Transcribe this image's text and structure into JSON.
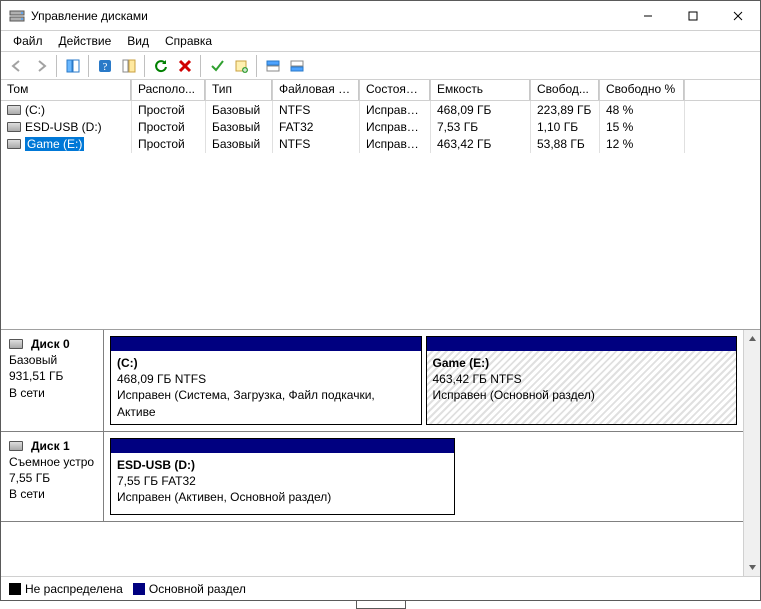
{
  "title": "Управление дисками",
  "menu": {
    "file": "Файл",
    "action": "Действие",
    "view": "Вид",
    "help": "Справка"
  },
  "columns": {
    "volume": "Том",
    "layout": "Располо...",
    "type": "Тип",
    "fs": "Файловая с...",
    "status": "Состояние",
    "capacity": "Емкость",
    "free": "Свобод...",
    "freepct": "Свободно %"
  },
  "volumes": [
    {
      "name": "(C:)",
      "layout": "Простой",
      "type": "Базовый",
      "fs": "NTFS",
      "status": "Исправен...",
      "capacity": "468,09 ГБ",
      "free": "223,89 ГБ",
      "freepct": "48 %",
      "selected": false
    },
    {
      "name": "ESD-USB (D:)",
      "layout": "Простой",
      "type": "Базовый",
      "fs": "FAT32",
      "status": "Исправен...",
      "capacity": "7,53 ГБ",
      "free": "1,10 ГБ",
      "freepct": "15 %",
      "selected": false
    },
    {
      "name": "Game (E:)",
      "layout": "Простой",
      "type": "Базовый",
      "fs": "NTFS",
      "status": "Исправен...",
      "capacity": "463,42 ГБ",
      "free": "53,88 ГБ",
      "freepct": "12 %",
      "selected": true
    }
  ],
  "disks": [
    {
      "label": "Диск 0",
      "type": "Базовый",
      "size": "931,51 ГБ",
      "state": "В сети",
      "partitions": [
        {
          "name": "(C:)",
          "line2": "468,09 ГБ NTFS",
          "line3": "Исправен (Система, Загрузка, Файл подкачки, Активе",
          "hatch": false
        },
        {
          "name": "Game  (E:)",
          "line2": "463,42 ГБ NTFS",
          "line3": "Исправен (Основной раздел)",
          "hatch": true
        }
      ]
    },
    {
      "label": "Диск 1",
      "type": "Съемное устро",
      "size": "7,55 ГБ",
      "state": "В сети",
      "partitions": [
        {
          "name": "ESD-USB  (D:)",
          "line2": "7,55 ГБ FAT32",
          "line3": "Исправен (Активен, Основной раздел)",
          "hatch": false,
          "flex": "0 0 55%"
        }
      ]
    }
  ],
  "legend": {
    "unallocated": "Не распределена",
    "primary": "Основной раздел"
  }
}
